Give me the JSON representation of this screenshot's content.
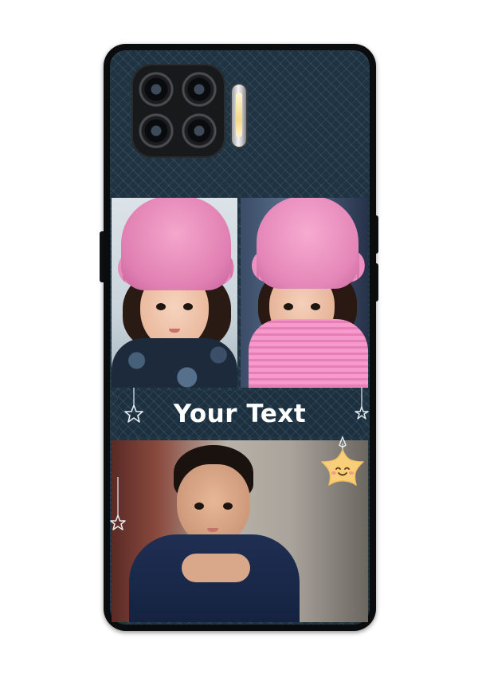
{
  "case": {
    "text_label": "Your Text",
    "colors": {
      "background": "#1f3341",
      "frame": "#0b0c0e",
      "text": "#ffffff",
      "hanging_star": "#f8cf78"
    }
  },
  "icons": [
    "camera-lens-icon",
    "flash-icon",
    "star-outline-icon",
    "smiling-star-icon"
  ]
}
